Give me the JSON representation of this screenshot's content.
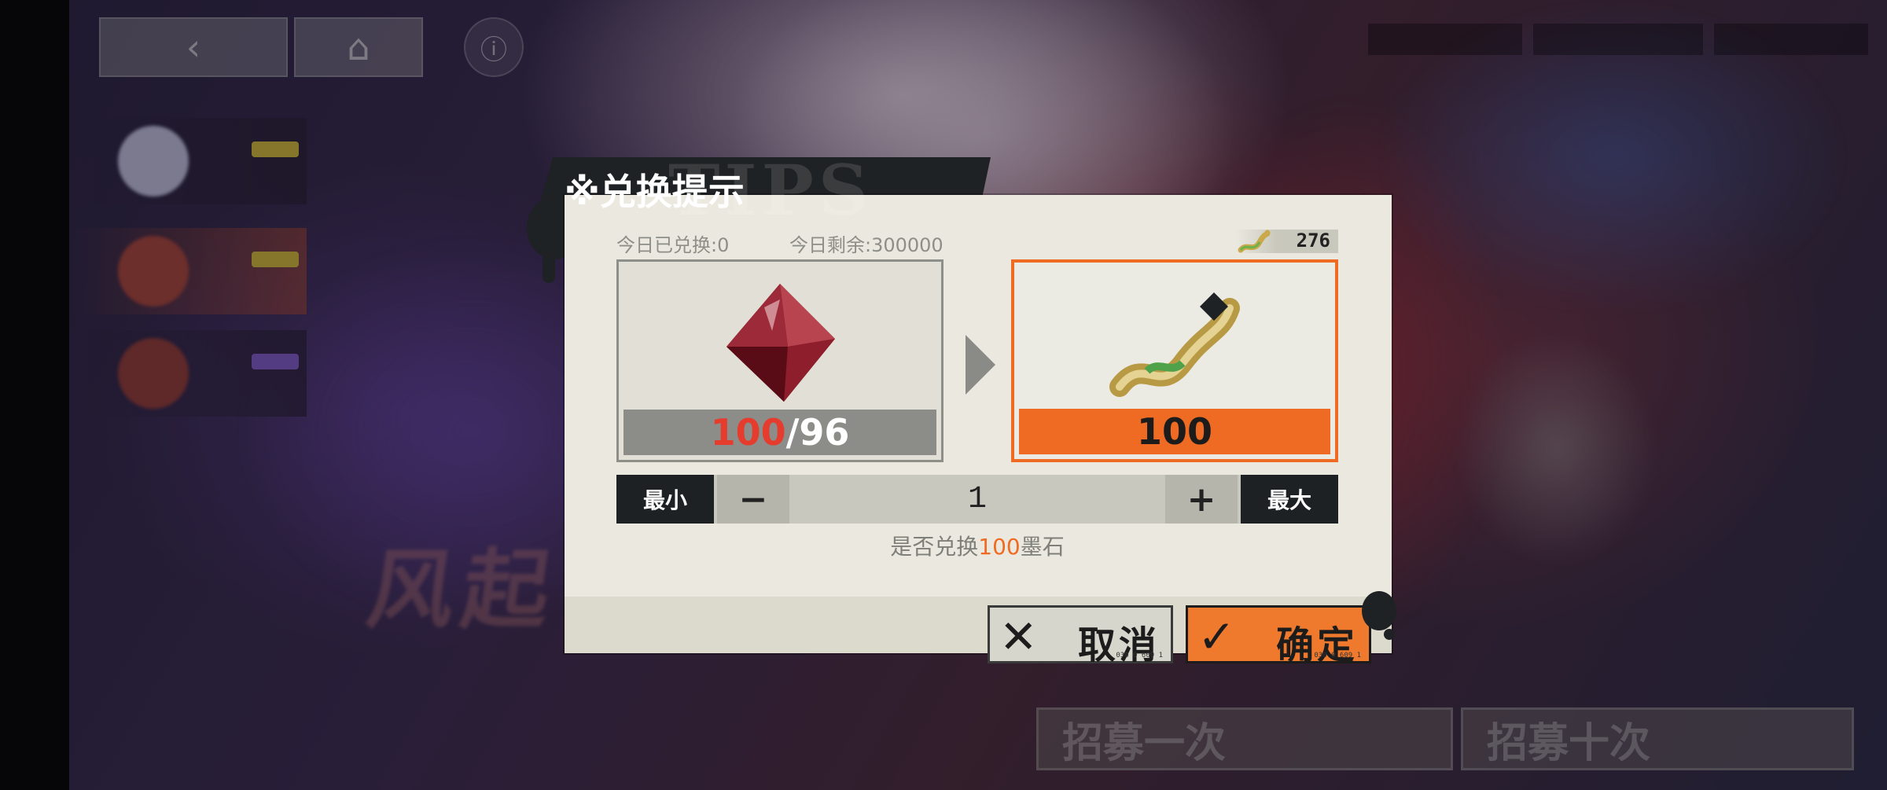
{
  "dialog": {
    "title": "※兑换提示",
    "today_used": "今日已兑换:0",
    "today_left": "今日剩余:300000",
    "owned_value": "276",
    "source": {
      "icon": "red-crystal-icon",
      "need": "100",
      "separator": "/",
      "have": "96"
    },
    "target": {
      "icon": "gold-ribbon-ink-stone-icon",
      "amount": "100"
    },
    "stepper": {
      "min_label": "最小",
      "minus_label": "−",
      "quantity": "1",
      "plus_label": "+",
      "max_label": "最大"
    },
    "confirm_prefix": "是否兑换",
    "confirm_amount": "100",
    "confirm_suffix": "墨石",
    "cancel_label": "取消",
    "ok_label": "确定",
    "button_code": "030 0 609 1"
  },
  "colors": {
    "accent": "#ef6b24",
    "warning": "#e53c2e",
    "panel": "#ebe9df",
    "dark": "#1e2123"
  }
}
